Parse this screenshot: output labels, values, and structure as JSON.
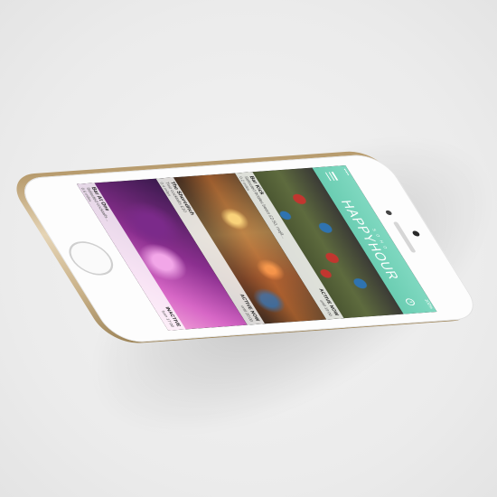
{
  "app": {
    "subtitle": "S O H O",
    "title": "HAPPYHOUR",
    "status_left": "•••••",
    "status_right": "100%"
  },
  "listings": [
    {
      "name": "Bar Kick",
      "offer": "Selected bottles beers £2.50, mojit...",
      "distance": "0.2 miles",
      "status": "ACTIVE NOW",
      "until": "until 19:00"
    },
    {
      "name": "The Shoreditch",
      "offer": "Two cocktails £10",
      "distance": "0.4 miles",
      "status": "ACTIVE NOW",
      "until": "until 20:00"
    },
    {
      "name": "Bar At One",
      "offer": "Selected cocktails...",
      "distance": "0.6 miles",
      "status": "INACTIVE",
      "until": "from 17:00"
    }
  ],
  "colors": {
    "accent": "#6bcdb2",
    "phone_frame": "#d9c39c",
    "phone_face": "#fdfdfd"
  },
  "icons": {
    "menu": "hamburger-icon",
    "clock": "clock-icon"
  }
}
